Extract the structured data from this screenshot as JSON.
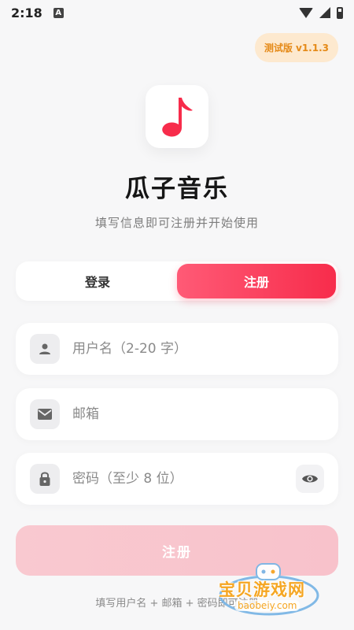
{
  "status_bar": {
    "time": "2:18",
    "notification_glyph": "A"
  },
  "version_badge": "测试版 v1.1.3",
  "app": {
    "title": "瓜子音乐",
    "subtitle": "填写信息即可注册并开始使用",
    "brand_color": "#f72c4b"
  },
  "tabs": [
    {
      "label": "登录",
      "active": false
    },
    {
      "label": "注册",
      "active": true
    }
  ],
  "form": {
    "username": {
      "placeholder": "用户名（2-20 字）",
      "value": "",
      "icon": "person-icon"
    },
    "email": {
      "placeholder": "邮箱",
      "value": "",
      "icon": "mail-icon"
    },
    "password": {
      "placeholder": "密码（至少 8 位）",
      "value": "",
      "icon": "lock-icon"
    }
  },
  "submit_label": "注册",
  "footer_hint": "填写用户名 + 邮箱 + 密码即可注册",
  "watermark": {
    "text": "宝贝游戏网",
    "sub": "baobeiy.com"
  }
}
